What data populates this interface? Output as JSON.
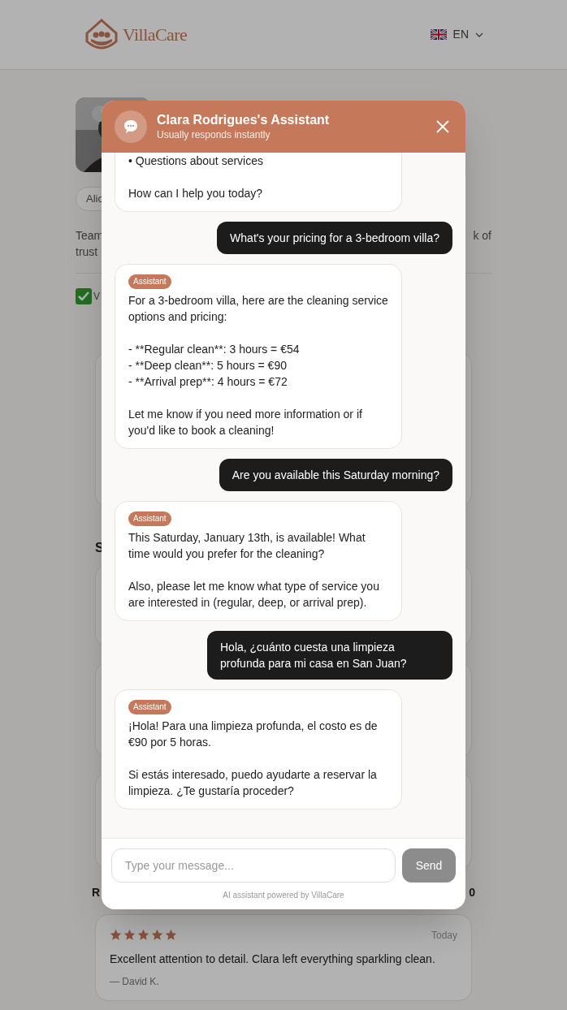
{
  "header": {
    "logo_text": "VillaCare",
    "language": "EN"
  },
  "profile": {
    "chip": "Alic",
    "bio_left": [
      "Team",
      "trust"
    ],
    "bio_right": "k of",
    "verified_fragment": "V"
  },
  "sections": [
    {
      "heading": "S"
    }
  ],
  "reviews_header": {
    "title": "R",
    "count": "0"
  },
  "review": {
    "stars": 5,
    "date": "Today",
    "text": "Excellent attention to detail. Clara left everything sparkling clean.",
    "author": "— David K."
  },
  "chat": {
    "title": "Clara Rodrigues's Assistant",
    "subtitle": "Usually responds instantly",
    "messages": [
      {
        "kind": "assistant",
        "text": "• Questions about services\n\nHow can I help you today?"
      },
      {
        "kind": "user",
        "text": "What's your pricing for a 3-bedroom villa?"
      },
      {
        "kind": "assistant",
        "badge": "Assistant",
        "text": "For a 3-bedroom villa, here are the cleaning service options and pricing:\n\n- **Regular clean**: 3 hours = €54\n- **Deep clean**: 5 hours = €90\n- **Arrival prep**: 4 hours = €72\n\nLet me know if you need more information or if you'd like to book a cleaning!"
      },
      {
        "kind": "user",
        "text": "Are you available this Saturday morning?"
      },
      {
        "kind": "assistant",
        "badge": "Assistant",
        "text": "This Saturday, January 13th, is available! What time would you prefer for the cleaning?\n\nAlso, please let me know what type of service you are interested in (regular, deep, or arrival prep)."
      },
      {
        "kind": "user",
        "text": "Hola, ¿cuánto cuesta una limpieza profunda para mi casa en San Juan?"
      },
      {
        "kind": "assistant",
        "badge": "Assistant",
        "text": "¡Hola! Para una limpieza profunda, el costo es de €90 por 5 horas.\n\nSi estás interesado, puedo ayudarte a reservar la limpieza. ¿Te gustaría proceder?"
      }
    ],
    "input": {
      "placeholder": "Type your message..."
    },
    "send": {
      "label": "Send",
      "disabled": true
    },
    "footer_note": "AI assistant powered by VillaCare"
  }
}
